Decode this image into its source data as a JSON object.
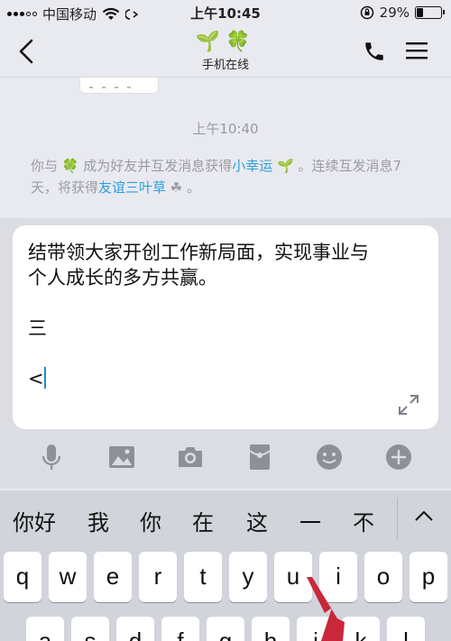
{
  "status_bar": {
    "carrier": "中国移动",
    "time": "上午10:45",
    "battery": "29%",
    "battery_level": 0.29
  },
  "nav": {
    "title_emoji": "🌱🍀",
    "status": "手机在线"
  },
  "chat": {
    "timestamp": "上午10:40",
    "sys_msg": {
      "part1": "你与 🍀 成为好友并互发消息获得",
      "link1": "小幸运",
      "part2": " 🌱 。连续互发消息7天，将获得",
      "link2": "友谊三叶草",
      "part3": " ☘ 。"
    }
  },
  "input": {
    "lines": [
      "结带领大家开创工作新局面，实现事业与",
      "个人成长的多方共赢。",
      "",
      "三",
      ""
    ],
    "last_line": "<"
  },
  "candidates": [
    "你好",
    "我",
    "你",
    "在",
    "这",
    "一",
    "不"
  ],
  "keyboard": {
    "row1": [
      "q",
      "w",
      "e",
      "r",
      "t",
      "y",
      "u",
      "i",
      "o",
      "p"
    ],
    "row2": [
      "a",
      "s",
      "d",
      "f",
      "g",
      "h",
      "j",
      "k",
      "l"
    ]
  },
  "colors": {
    "accent": "#2f9edb",
    "caret": "#1f8ad6",
    "arrow": "#c8283a"
  }
}
